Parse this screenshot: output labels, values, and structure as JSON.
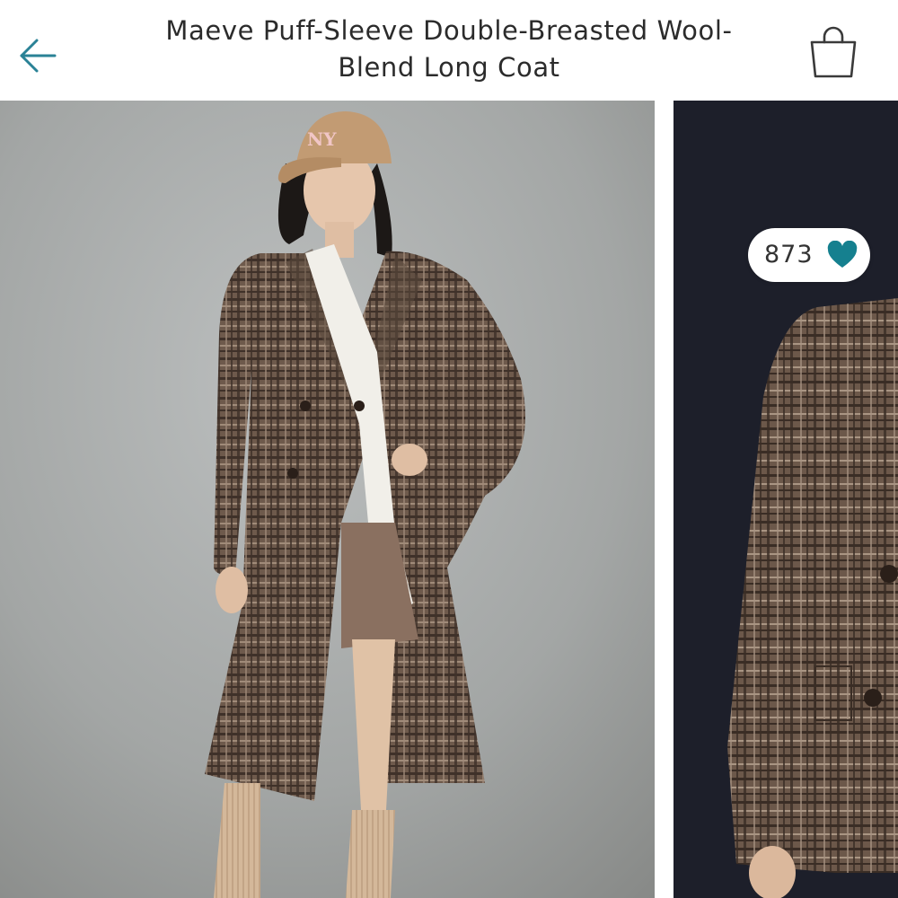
{
  "header": {
    "back_icon": "arrow-left-icon",
    "title": "Maeve Puff-Sleeve Double-Breasted Wool-Blend Long Coat",
    "bag_icon": "shopping-bag-icon"
  },
  "gallery": {
    "images": [
      {
        "alt": "Model wearing brown plaid double-breasted long coat with tan cap"
      },
      {
        "alt": "Close-up of plaid coat sleeve, pocket flap and buttons"
      }
    ],
    "likes": {
      "count": "873",
      "icon": "heart-icon"
    }
  },
  "colors": {
    "accent": "#2a8296",
    "heart": "#15808f",
    "text": "#2b2b2b"
  }
}
